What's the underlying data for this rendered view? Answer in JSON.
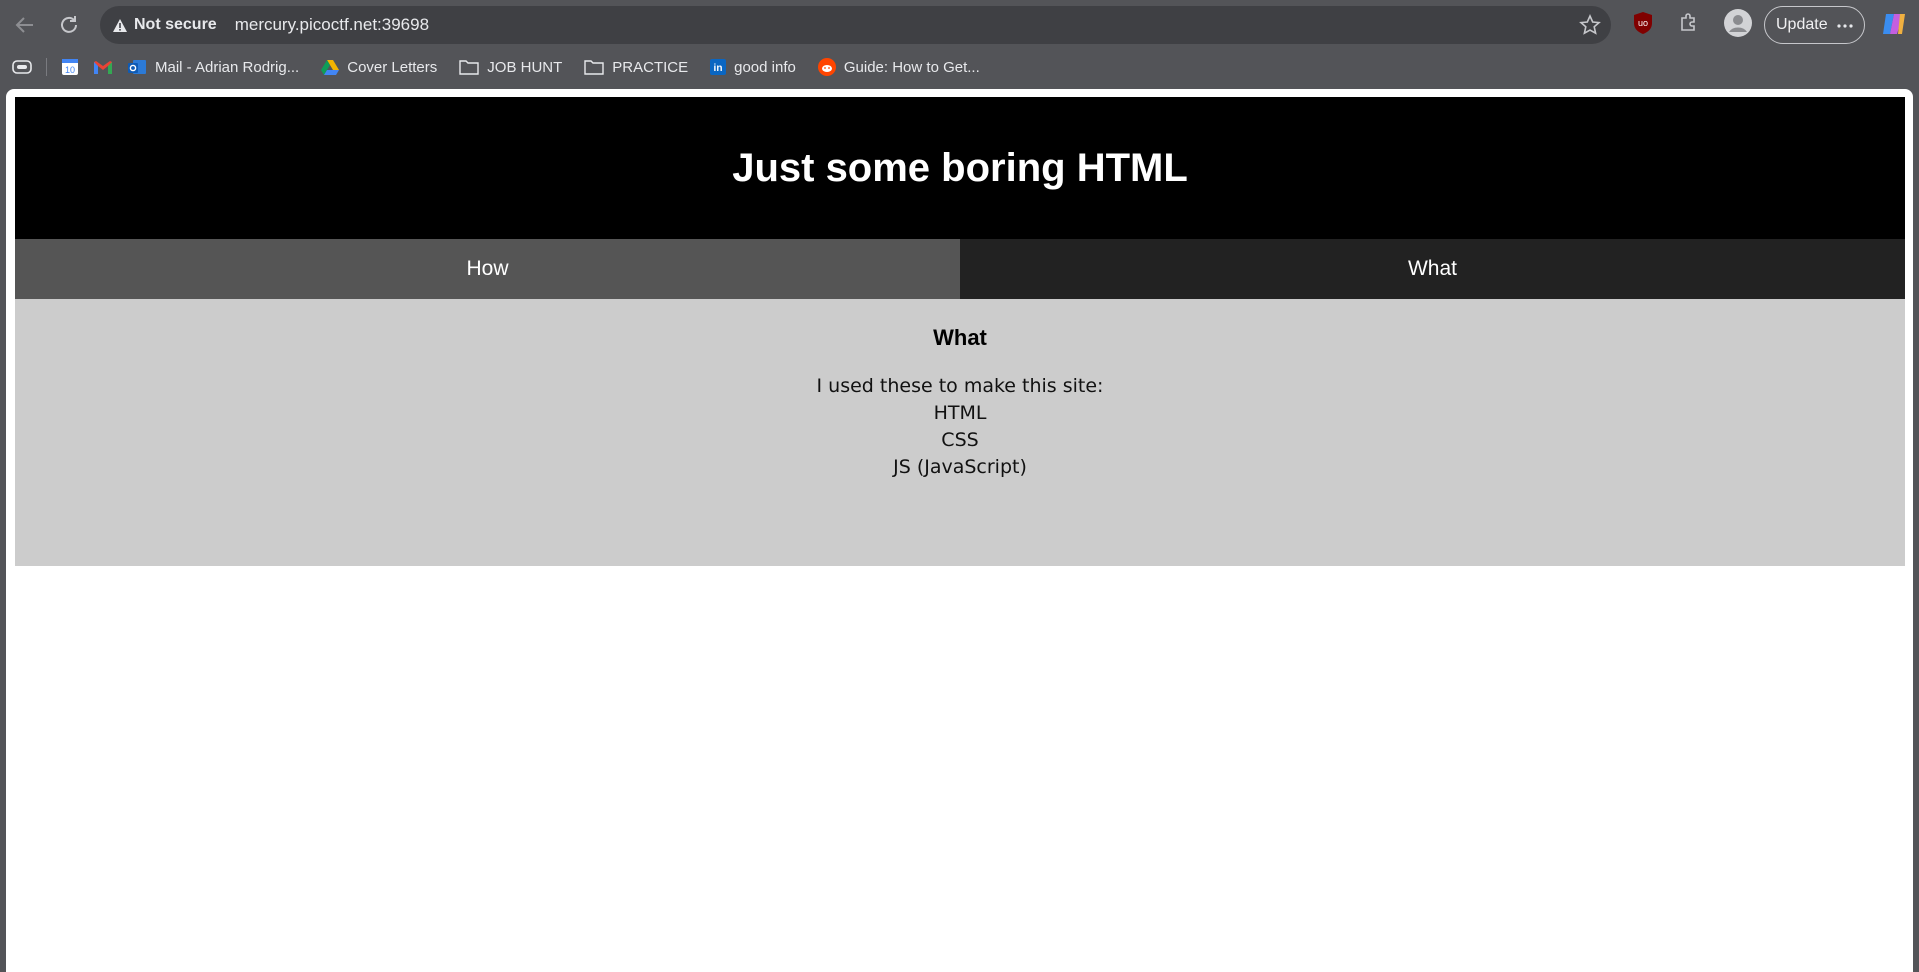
{
  "browser": {
    "security_label": "Not secure",
    "url": "mercury.picoctf.net:39698",
    "update_label": "Update",
    "bookmarks": [
      {
        "label": "Mail - Adrian Rodrig..."
      },
      {
        "label": "Cover Letters"
      },
      {
        "label": "JOB HUNT"
      },
      {
        "label": "PRACTICE"
      },
      {
        "label": "good info"
      },
      {
        "label": "Guide: How to Get..."
      }
    ],
    "calendar_day": "10"
  },
  "site": {
    "title": "Just some boring HTML",
    "tabs": [
      {
        "label": "How"
      },
      {
        "label": "What"
      }
    ],
    "panel": {
      "heading": "What",
      "intro": "I used these to make this site:",
      "items": [
        "HTML",
        "CSS",
        "JS (JavaScript)"
      ]
    }
  },
  "colors": {
    "banner": "#000000",
    "tab_how": "#555555",
    "tab_what": "#222222",
    "panel": "#cccccc"
  }
}
